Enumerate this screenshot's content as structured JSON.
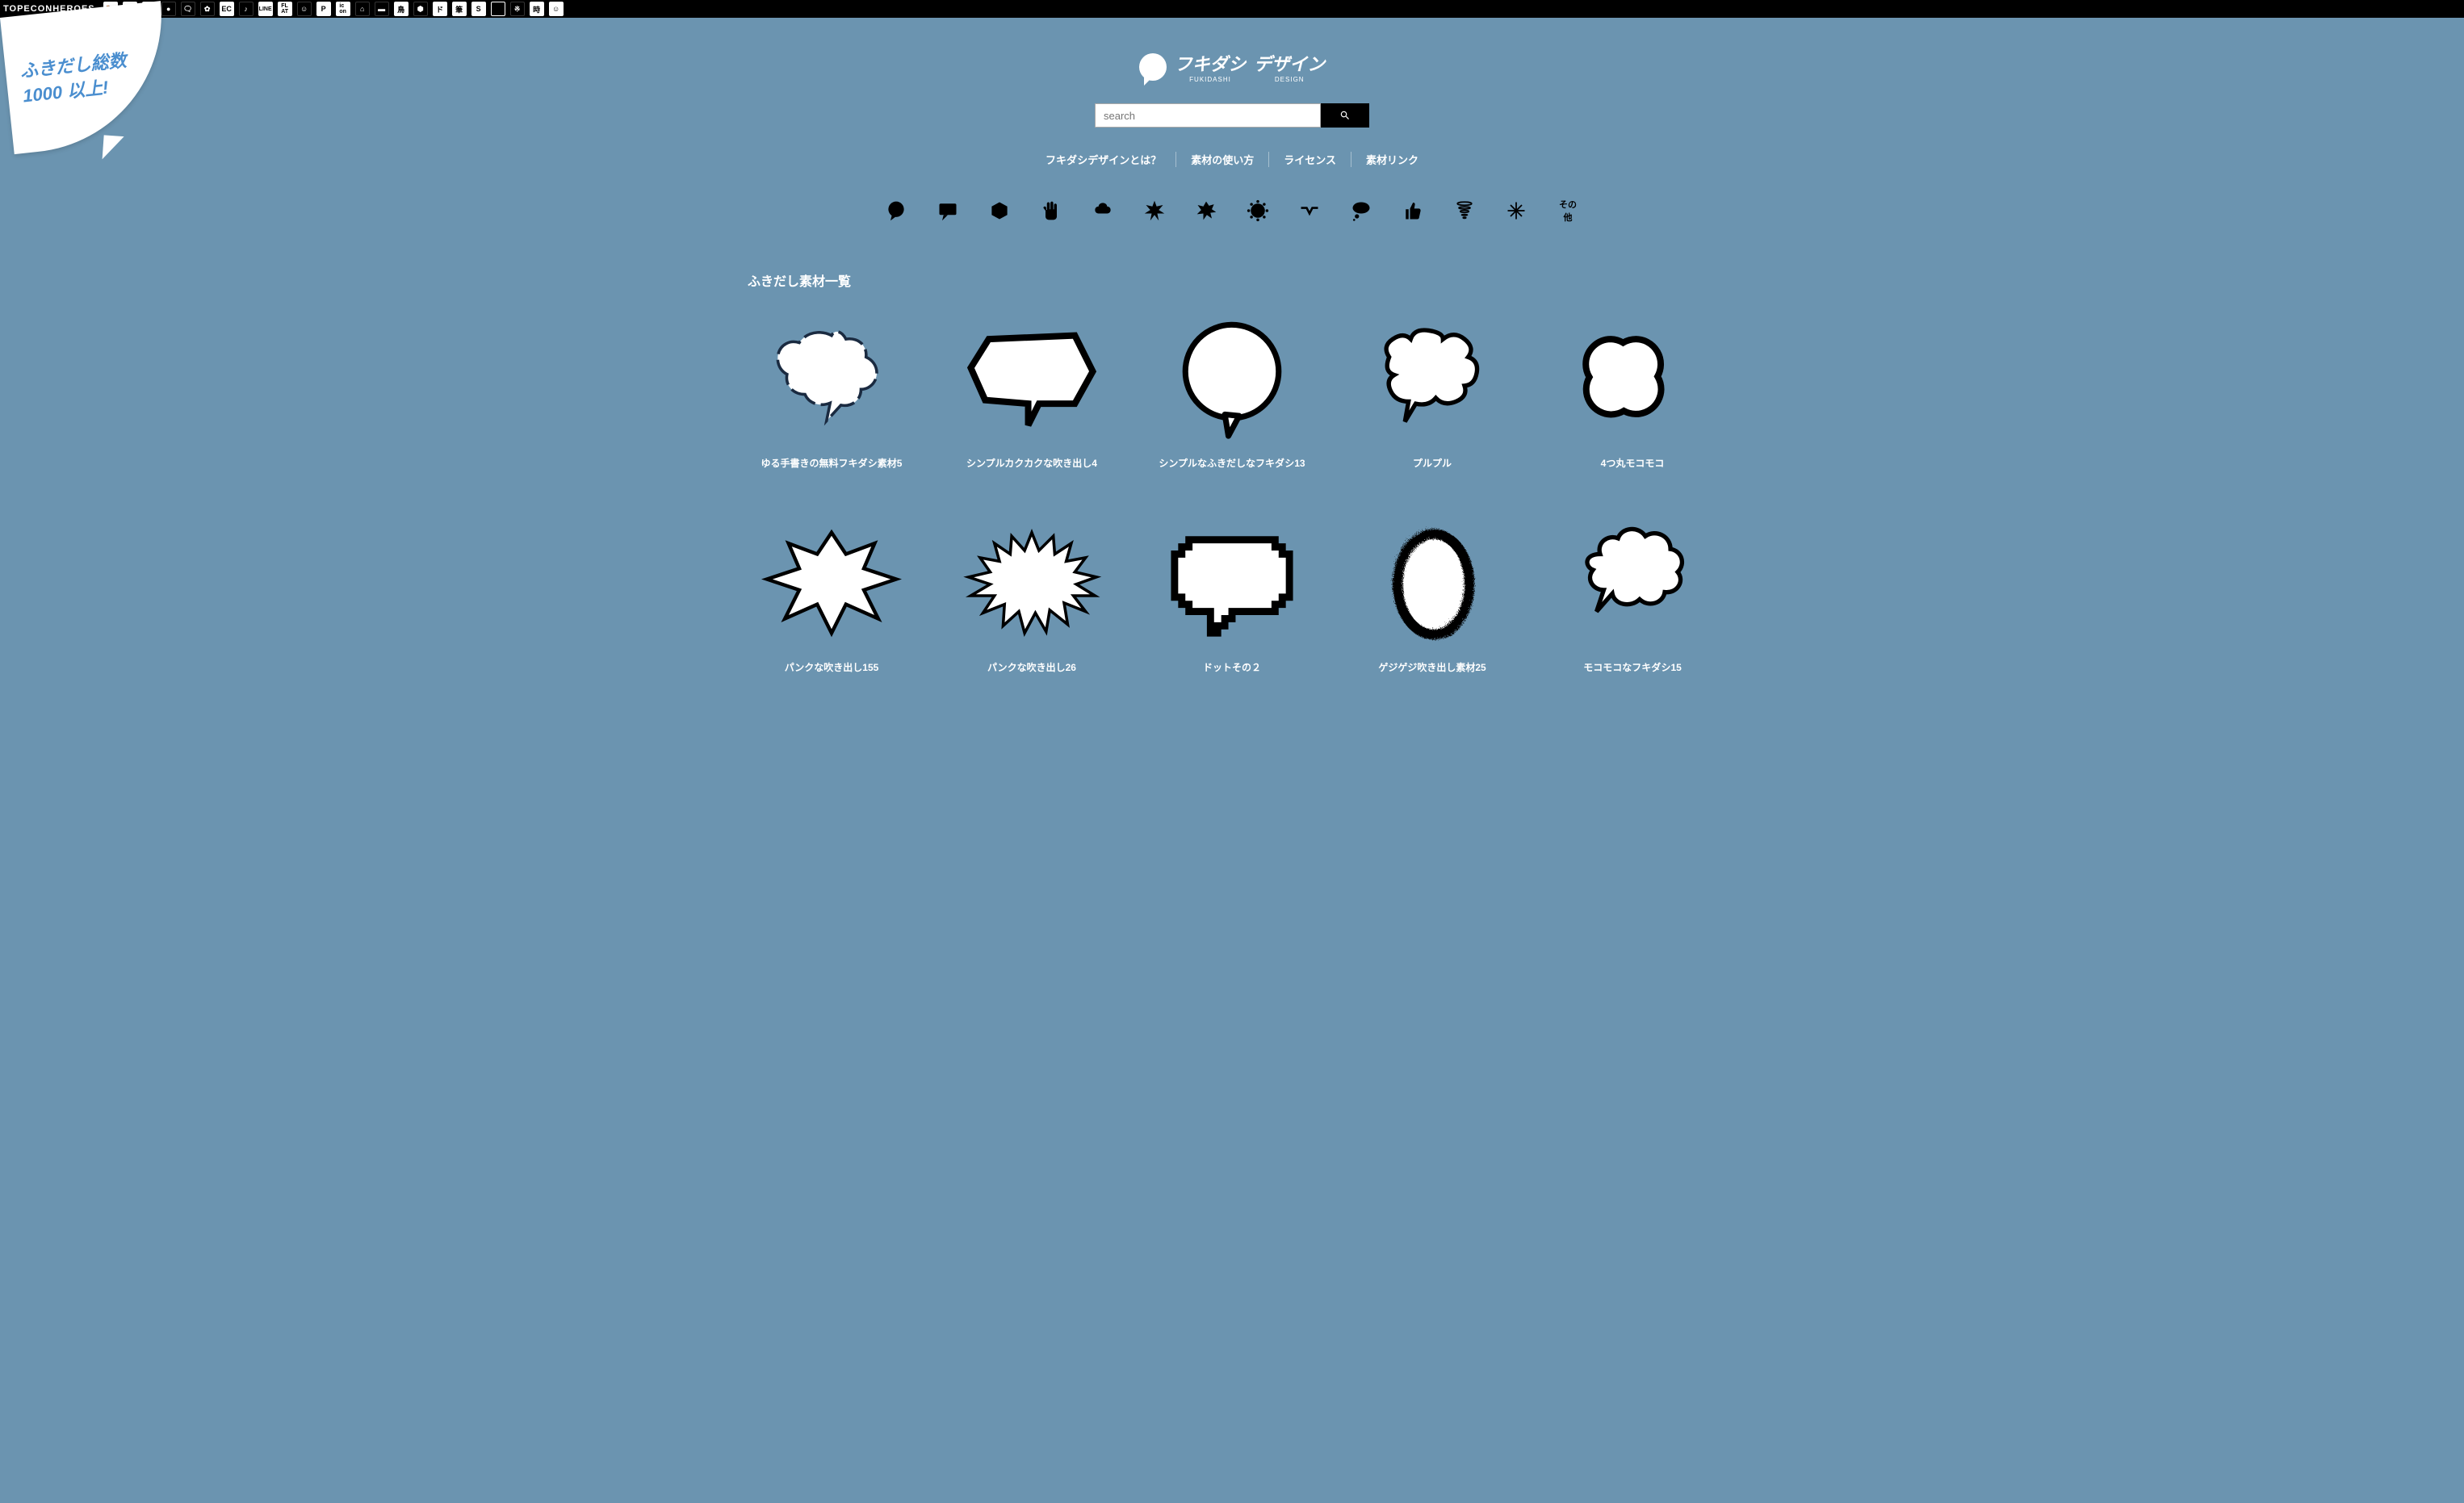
{
  "topbar": {
    "brand": "TopeconHeroes",
    "icons": [
      "🐎",
      "▢",
      "Y",
      "●",
      "🗨",
      "✿",
      "EC",
      "♪",
      "LINE",
      "FLAT",
      "☺",
      "P",
      "icon",
      "⌂",
      "▬",
      "鳥",
      "⬢",
      "ド",
      "筆",
      "S",
      "▦",
      "※",
      "時",
      "☺"
    ]
  },
  "promo": {
    "line1": "ふきだし総数",
    "line2": "1000 以上!"
  },
  "logo": {
    "word1": "フキダシ",
    "sub1": "FUKIDASHI",
    "word2": "デザイン",
    "sub2": "DESIGN"
  },
  "search": {
    "placeholder": "search"
  },
  "nav": [
    "フキダシデザインとは？",
    "素材の使い方",
    "ライセンス",
    "素材リンク"
  ],
  "cats_last": "その他",
  "section_title": "ふきだし素材一覧",
  "items": [
    {
      "caption": "ゆる手書きの無料フキダシ素材5"
    },
    {
      "caption": "シンプルカクカクな吹き出し4"
    },
    {
      "caption": "シンプルなふきだしなフキダシ13"
    },
    {
      "caption": "プルプル"
    },
    {
      "caption": "4つ丸モコモコ"
    },
    {
      "caption": "パンクな吹き出し155"
    },
    {
      "caption": "パンクな吹き出し26"
    },
    {
      "caption": "ドットその２"
    },
    {
      "caption": "ゲジゲジ吹き出し素材25"
    },
    {
      "caption": "モコモコなフキダシ15"
    }
  ]
}
